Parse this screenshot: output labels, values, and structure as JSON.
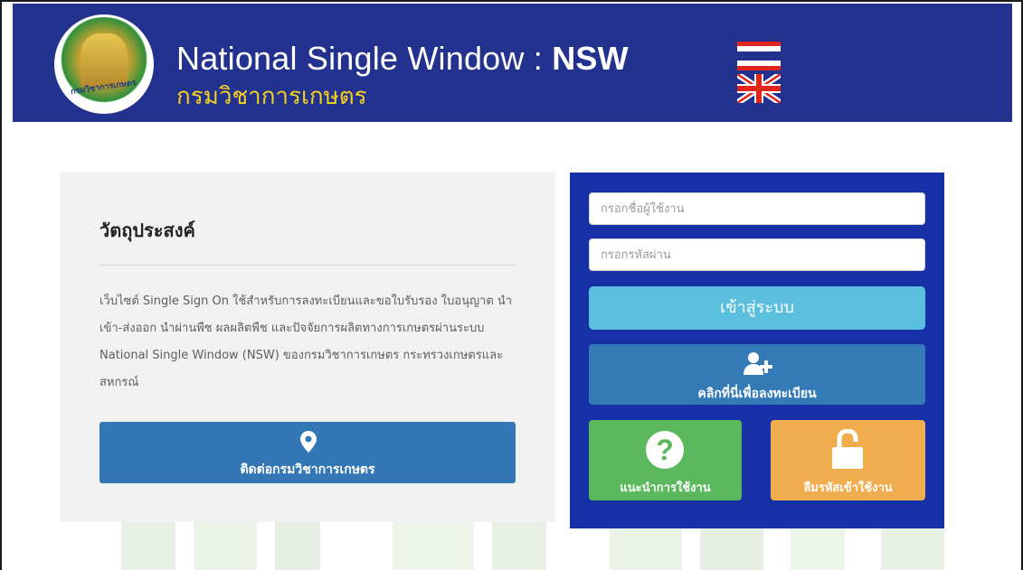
{
  "header": {
    "logo_text": "กรมวิชาการเกษตร",
    "title_prefix": "National Single Window : ",
    "title_strong": "NSW",
    "subtitle": "กรมวิชาการเกษตร",
    "languages": [
      "thai-flag-icon",
      "uk-flag-icon"
    ]
  },
  "objective": {
    "title": "วัตถุประสงค์",
    "description": "เว็บไซต์ Single Sign On ใช้สำหรับการลงทะเบียนและขอใบรับรอง ใบอนุญาต นำเข้า-ส่งออก นำผ่านพืช ผลผลิตพืช และปัจจัยการผลิตทางการเกษตรผ่านระบบ National Single Window (NSW) ของกรมวิชาการเกษตร กระทรวงเกษตรและสหกรณ์",
    "contact_icon": "map-marker-icon",
    "contact_label": "ติดต่อกรมวิชาการเกษตร"
  },
  "login": {
    "username_placeholder": "กรอกชื่อผู้ใช้งาน",
    "password_placeholder": "กรอกรหัสผ่าน",
    "login_label": "เข้าสู่ระบบ",
    "register_icon": "add-user-icon",
    "register_label": "คลิกที่นี่เพื่อลงทะเบียน",
    "help_icon": "question-circle-icon",
    "help_label": "แนะนำการใช้งาน",
    "forgot_icon": "unlock-icon",
    "forgot_label": "ลืมรหัสเข้าใช้งาน"
  },
  "colors": {
    "header_bg": "#23328f",
    "subtitle": "#f6d21f",
    "login_panel": "#1631a6",
    "login_button": "#5bc0de",
    "register_button": "#337ab7",
    "help_button": "#5cb85c",
    "forgot_button": "#f0ad4e",
    "contact_button": "#3377b6"
  }
}
